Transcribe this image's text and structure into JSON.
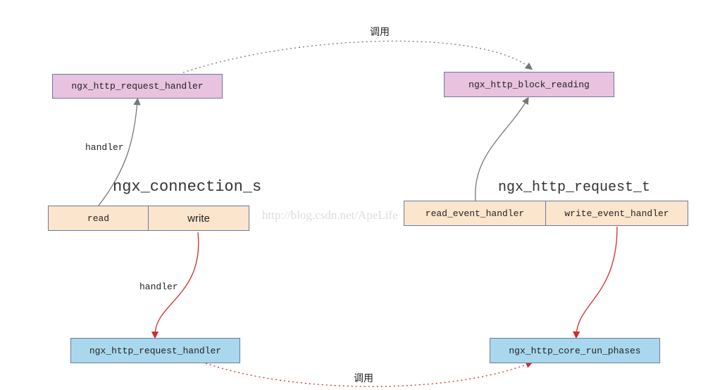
{
  "top_left": {
    "label": "ngx_http_request_handler"
  },
  "top_right": {
    "label": "ngx_http_block_reading"
  },
  "bottom_left": {
    "label": "ngx_http_request_handler"
  },
  "bottom_right": {
    "label": "ngx_http_core_run_phases"
  },
  "connection": {
    "title": "ngx_connection_s",
    "read": "read",
    "write": "write"
  },
  "request": {
    "title": "ngx_http_request_t",
    "read": "read_event_handler",
    "write": "write_event_handler"
  },
  "edges": {
    "top_call": "调用",
    "bottom_call": "调用",
    "handler_read": "handler",
    "handler_write": "handler"
  },
  "watermark": "http://blog.csdn.net/ApeLife",
  "colors": {
    "pink": "#e8c2df",
    "peach": "#fbe5cc",
    "blue": "#a9d8ee",
    "gray_arrow": "#777777",
    "red_arrow": "#d42a2a"
  }
}
